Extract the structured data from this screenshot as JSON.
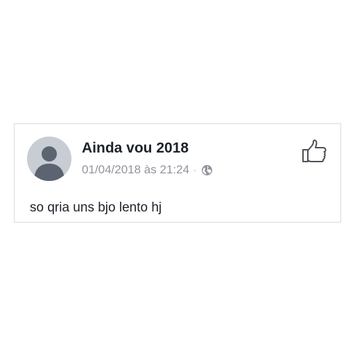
{
  "post": {
    "author": "Ainda vou 2018",
    "timestamp": "01/04/2018 às 21:24",
    "separator": "·",
    "privacy_icon": "globe-icon",
    "text": "so qria uns bjo lento hj",
    "avatar_icon": "default-avatar-icon",
    "action_icon": "thumbs-up-icon"
  },
  "colors": {
    "name": "#1d2129",
    "meta": "#90949c",
    "border": "#d9dadc",
    "avatar_bg": "#c8cdd4",
    "avatar_figure": "#5b6470"
  }
}
